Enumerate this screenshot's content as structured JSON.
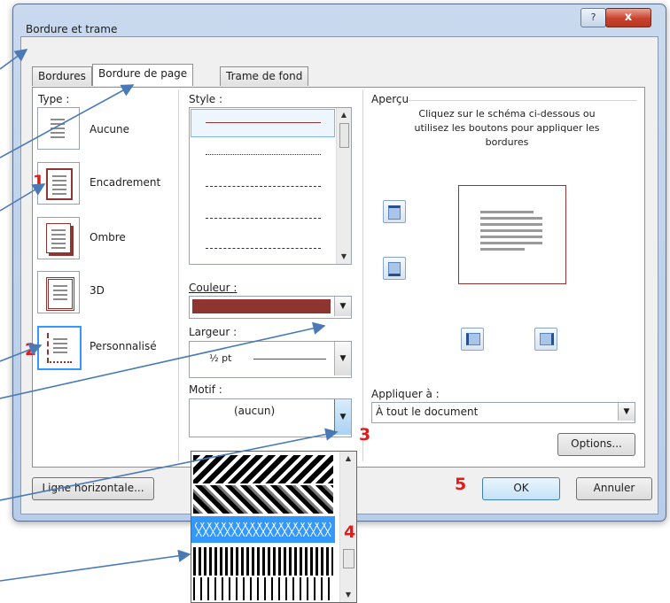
{
  "window": {
    "title": "Bordure et trame",
    "help": "?",
    "close": "x"
  },
  "tabs": [
    {
      "label": "Bordures"
    },
    {
      "label": "Bordure de page"
    },
    {
      "label": "Trame de fond"
    }
  ],
  "type": {
    "label": "Type :",
    "items": [
      {
        "label": "Aucune"
      },
      {
        "label": "Encadrement"
      },
      {
        "label": "Ombre"
      },
      {
        "label": "3D"
      },
      {
        "label": "Personnalisé"
      }
    ]
  },
  "style": {
    "label": "Style :"
  },
  "couleur": {
    "label": "Couleur :",
    "value_color": "#8e3531"
  },
  "largeur": {
    "label": "Largeur :",
    "value": "½ pt"
  },
  "motif": {
    "label": "Motif :",
    "value": "(aucun)"
  },
  "apercu": {
    "label": "Aperçu",
    "hint": "Cliquez sur le schéma ci-dessous ou utilisez les boutons pour appliquer les bordures"
  },
  "appliquer": {
    "label": "Appliquer à :",
    "value": "À tout le document"
  },
  "buttons": {
    "options": "Options...",
    "ligne": "Ligne horizontale...",
    "ok": "OK",
    "annuler": "Annuler"
  },
  "annotations": {
    "n1": "1",
    "n2": "2",
    "n3": "3",
    "n4": "4",
    "n5": "5"
  },
  "colors": {
    "accent": "#3399ff",
    "annotation": "#e31b1b",
    "arrow": "#4a7ab5"
  }
}
